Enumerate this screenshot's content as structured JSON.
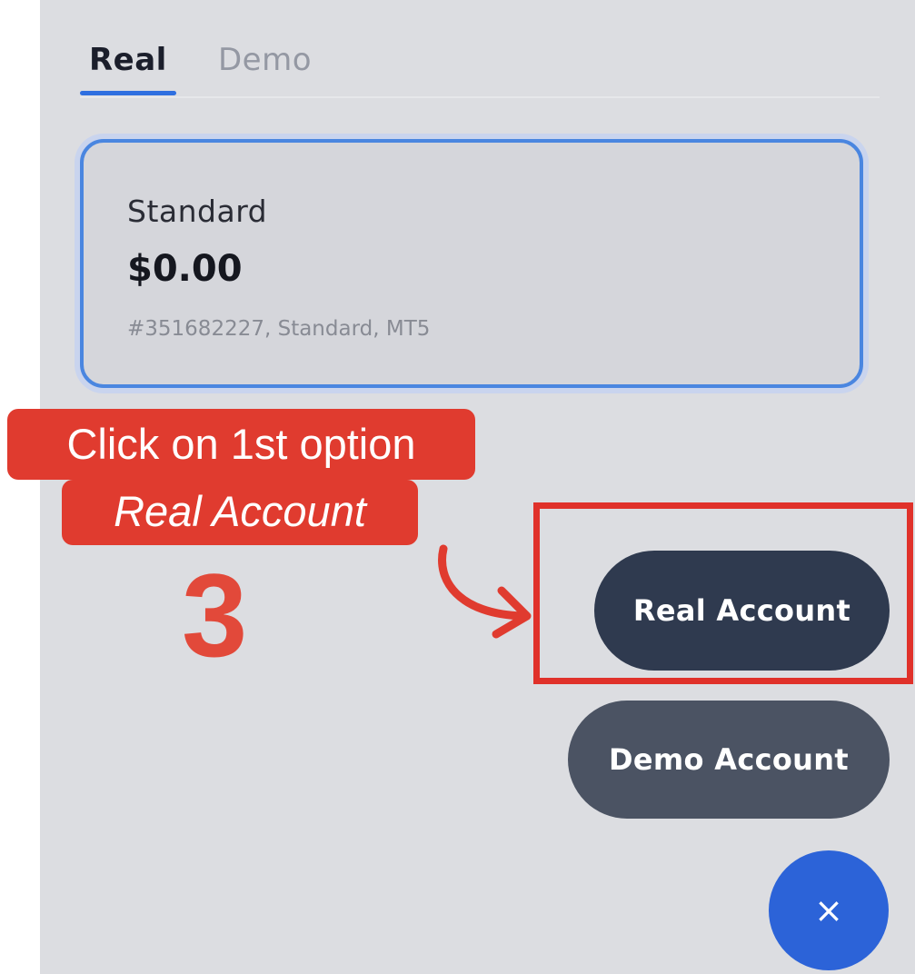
{
  "tabs": {
    "real_label": "Real",
    "demo_label": "Demo",
    "active": "Real"
  },
  "account_card": {
    "type": "Standard",
    "balance": "$0.00",
    "meta": "#351682227, Standard, MT5"
  },
  "annotation": {
    "line1": "Click on 1st option",
    "line2": "Real Account",
    "step_number": "3"
  },
  "fab_menu": {
    "real_account_label": "Real Account",
    "demo_account_label": "Demo Account",
    "close_icon": "close-icon",
    "close_glyph": "×"
  },
  "colors": {
    "accent_blue": "#2c63d8",
    "annotation_red": "#e03b2f",
    "real_button": "#2f3a4f",
    "demo_button": "#4b5363"
  }
}
